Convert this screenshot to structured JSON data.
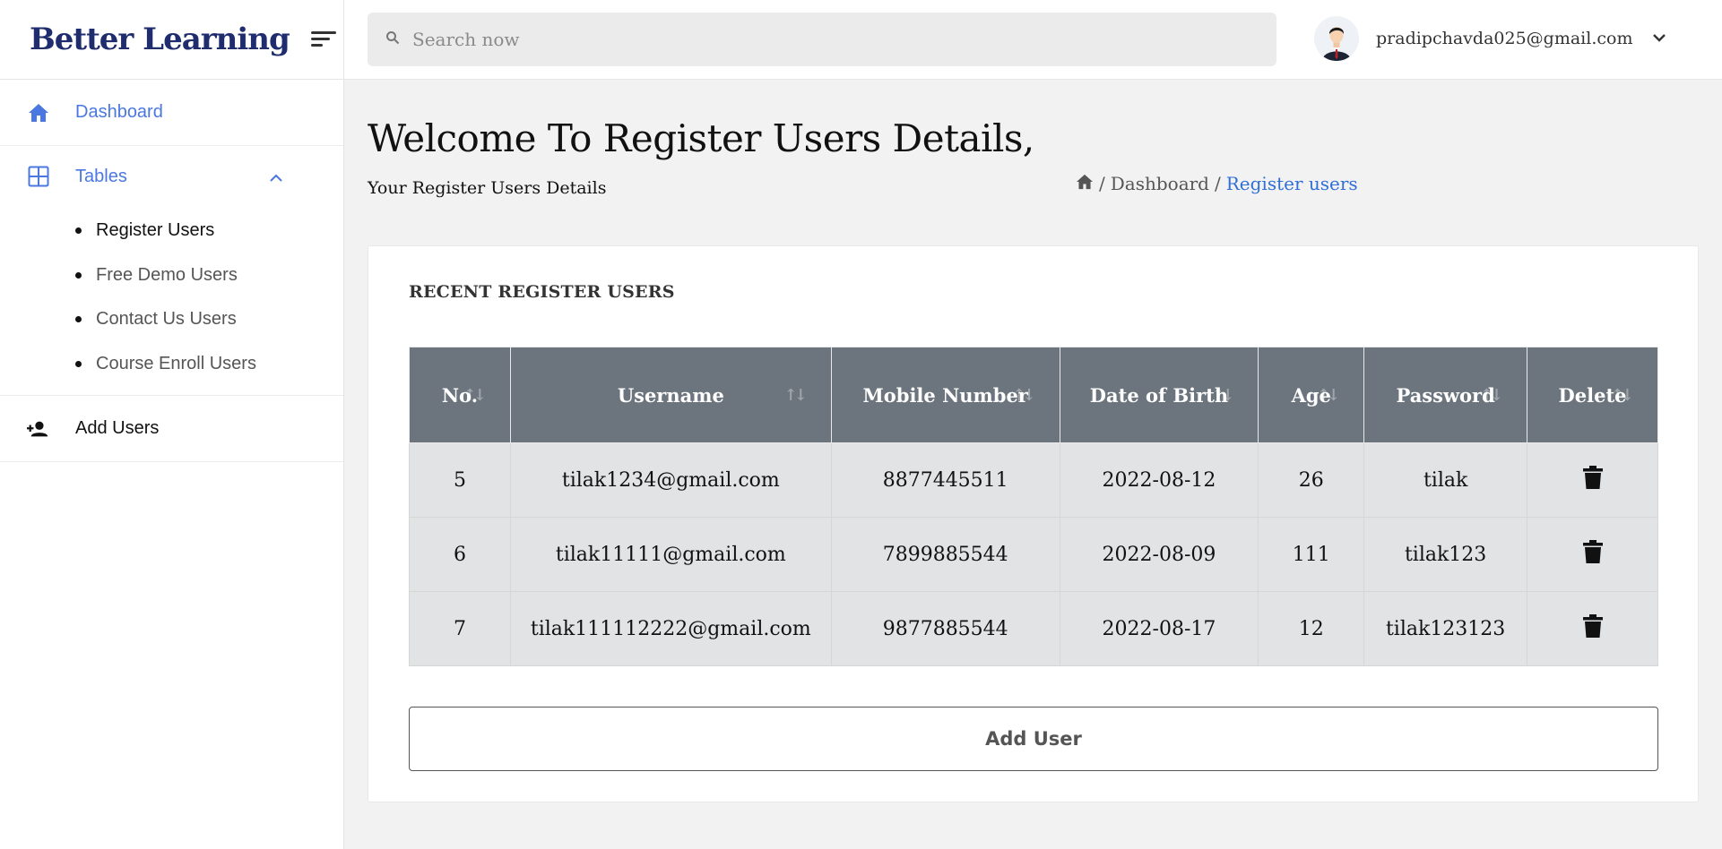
{
  "brand": {
    "name": "Better Learning"
  },
  "search": {
    "placeholder": "Search now"
  },
  "user": {
    "email": "pradipchavda025@gmail.com"
  },
  "sidebar": {
    "dashboard_label": "Dashboard",
    "tables_label": "Tables",
    "sub_items": [
      {
        "label": "Register Users"
      },
      {
        "label": "Free Demo Users"
      },
      {
        "label": "Contact Us Users"
      },
      {
        "label": "Course Enroll Users"
      }
    ],
    "add_users_label": "Add Users"
  },
  "page": {
    "title": "Welcome To Register Users Details,",
    "subtitle": "Your Register Users Details"
  },
  "breadcrumb": {
    "sep1": "/",
    "dashboard": "Dashboard",
    "sep2": "/",
    "current": "Register users"
  },
  "card": {
    "title": "RECENT REGISTER USERS"
  },
  "table": {
    "headers": [
      "No.",
      "Username",
      "Mobile Number",
      "Date of Birth",
      "Age",
      "Password",
      "Delete"
    ],
    "rows": [
      {
        "no": "5",
        "username": "tilak1234@gmail.com",
        "mobile": "8877445511",
        "dob": "2022-08-12",
        "age": "26",
        "password": "tilak"
      },
      {
        "no": "6",
        "username": "tilak11111@gmail.com",
        "mobile": "7899885544",
        "dob": "2022-08-09",
        "age": "111",
        "password": "tilak123"
      },
      {
        "no": "7",
        "username": "tilak111112222@gmail.com",
        "mobile": "9877885544",
        "dob": "2022-08-17",
        "age": "12",
        "password": "tilak123123"
      }
    ]
  },
  "add_button": {
    "label": "Add User"
  },
  "colors": {
    "accent": "#4a78e0",
    "brand": "#1f2d6e",
    "table_header": "#6c757d",
    "table_row": "#e2e3e5",
    "link": "#2f6fd6"
  },
  "icons": [
    "menu-icon",
    "home-icon",
    "grid-icon",
    "chevron-up-icon",
    "person-add-icon",
    "search-icon",
    "avatar",
    "chevron-down-icon",
    "sort-icon",
    "trash-icon"
  ]
}
